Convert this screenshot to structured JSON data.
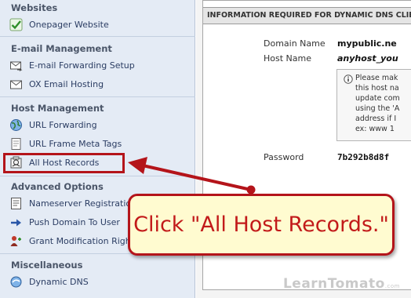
{
  "sidebar": {
    "sections": [
      {
        "header": "Websites",
        "items": [
          {
            "label": "Onepager Website",
            "icon": "checkmark-icon"
          }
        ]
      },
      {
        "header": "E-mail Management",
        "items": [
          {
            "label": "E-mail Forwarding Setup",
            "icon": "envelope-forward-icon"
          },
          {
            "label": "OX Email Hosting",
            "icon": "envelope-icon"
          }
        ]
      },
      {
        "header": "Host Management",
        "items": [
          {
            "label": "URL Forwarding",
            "icon": "globe-icon"
          },
          {
            "label": "URL Frame Meta Tags",
            "icon": "document-icon"
          },
          {
            "label": "All Host Records",
            "icon": "host-records-icon"
          }
        ]
      },
      {
        "header": "Advanced Options",
        "items": [
          {
            "label": "Nameserver Registration",
            "icon": "nameserver-icon"
          },
          {
            "label": "Push Domain To User",
            "icon": "push-arrow-icon"
          },
          {
            "label": "Grant Modification Rights",
            "icon": "user-rights-icon"
          }
        ]
      },
      {
        "header": "Miscellaneous",
        "items": [
          {
            "label": "Dynamic DNS",
            "icon": "dynamic-dns-icon"
          }
        ]
      }
    ]
  },
  "main": {
    "panel_title": "INFORMATION REQUIRED FOR DYNAMIC DNS CLIENT",
    "fields": [
      {
        "label": "Domain Name",
        "value": "mypublic.ne"
      },
      {
        "label": "Host Name",
        "value": "anyhost_you"
      },
      {
        "label": "Password",
        "value": "7b292b8d8f"
      }
    ],
    "note": "Please mak\nthis host na\nupdate com\nusing the 'A\naddress if I\nex: www 1"
  },
  "annotation": {
    "callout_text": "Click \"All Host Records.\"",
    "highlight_color": "#b4141a",
    "callout_bg": "#fffbd0"
  },
  "watermark": {
    "brand": "LearnTomato",
    "suffix": ".com"
  }
}
